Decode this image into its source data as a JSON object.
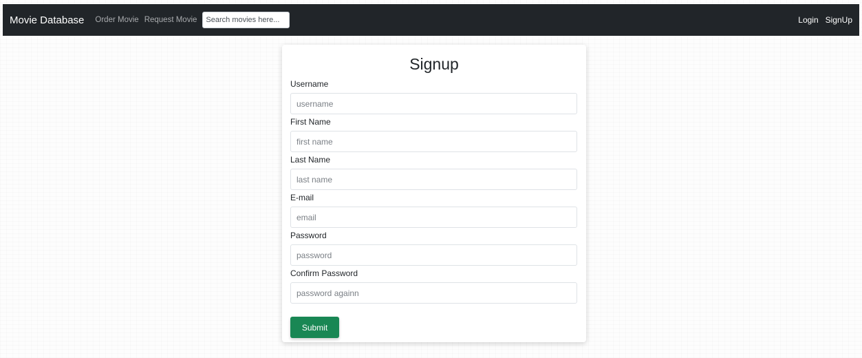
{
  "navbar": {
    "brand": "Movie Database",
    "links": [
      "Order Movie",
      "Request Movie"
    ],
    "search_placeholder": "Search movies here...",
    "right_links": [
      "Login",
      "SignUp"
    ],
    "background_color": "#212529"
  },
  "form": {
    "title": "Signup",
    "fields": [
      {
        "label": "Username",
        "placeholder": "username"
      },
      {
        "label": "First Name",
        "placeholder": "first name"
      },
      {
        "label": "Last Name",
        "placeholder": "last name"
      },
      {
        "label": "E-mail",
        "placeholder": "email"
      },
      {
        "label": "Password",
        "placeholder": "password"
      },
      {
        "label": "Confirm Password",
        "placeholder": "password againn"
      }
    ],
    "submit_label": "Submit",
    "submit_color": "#198754"
  }
}
